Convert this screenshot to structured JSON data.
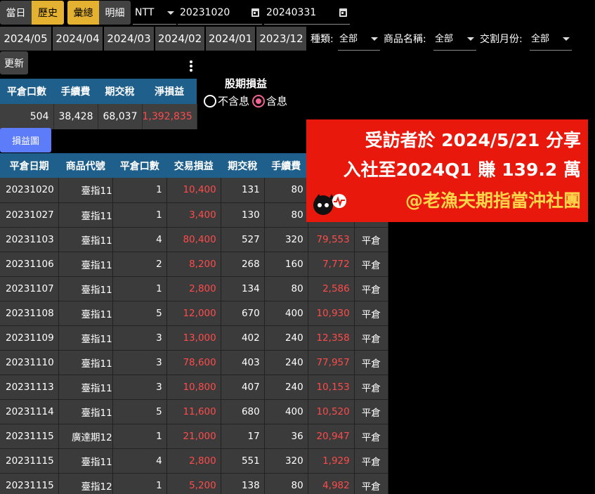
{
  "toolbar": {
    "range_tabs": [
      "當日",
      "歷史"
    ],
    "view_tabs": [
      "彙總",
      "明細"
    ],
    "currency": "NTT",
    "start_date": "20231020",
    "end_date": "20240331",
    "update_label": "更新",
    "chart_label": "損益圖"
  },
  "months": [
    "2024/05",
    "2024/04",
    "2024/03",
    "2024/02",
    "2024/01",
    "2023/12"
  ],
  "filters": {
    "type_label": "種類:",
    "type_value": "全部",
    "product_label": "商品名稱:",
    "product_value": "全部",
    "month_label": "交割月份:",
    "month_value": "全部"
  },
  "summary": {
    "headers": [
      "平倉口數",
      "手續費",
      "期交稅",
      "淨損益"
    ],
    "values": [
      "504",
      "38,428",
      "68,037",
      "1,392,835"
    ]
  },
  "interest": {
    "title": "股期損益",
    "options": [
      "不含息",
      "含息"
    ],
    "selected": "含息"
  },
  "detail": {
    "headers": [
      "平倉日期",
      "商品代號",
      "平倉口數",
      "交易損益",
      "期交稅",
      "手續費",
      "",
      ""
    ],
    "rows": [
      [
        "20231020",
        "臺指11",
        "1",
        "10,400",
        "131",
        "80",
        "",
        ""
      ],
      [
        "20231027",
        "臺指11",
        "1",
        "3,400",
        "130",
        "80",
        "",
        ""
      ],
      [
        "20231103",
        "臺指11",
        "4",
        "80,400",
        "527",
        "320",
        "79,553",
        "平倉"
      ],
      [
        "20231106",
        "臺指11",
        "2",
        "8,200",
        "268",
        "160",
        "7,772",
        "平倉"
      ],
      [
        "20231107",
        "臺指11",
        "1",
        "2,800",
        "134",
        "80",
        "2,586",
        "平倉"
      ],
      [
        "20231108",
        "臺指11",
        "5",
        "12,000",
        "670",
        "400",
        "10,930",
        "平倉"
      ],
      [
        "20231109",
        "臺指11",
        "3",
        "13,000",
        "402",
        "240",
        "12,358",
        "平倉"
      ],
      [
        "20231110",
        "臺指11",
        "3",
        "78,600",
        "403",
        "240",
        "77,957",
        "平倉"
      ],
      [
        "20231113",
        "臺指11",
        "3",
        "10,800",
        "407",
        "240",
        "10,153",
        "平倉"
      ],
      [
        "20231114",
        "臺指11",
        "5",
        "11,600",
        "680",
        "400",
        "10,520",
        "平倉"
      ],
      [
        "20231115",
        "廣達期12",
        "1",
        "21,000",
        "17",
        "36",
        "20,947",
        "平倉"
      ],
      [
        "20231115",
        "臺指11",
        "4",
        "2,800",
        "551",
        "320",
        "1,929",
        "平倉"
      ],
      [
        "20231115",
        "臺指12",
        "1",
        "5,200",
        "138",
        "80",
        "4,982",
        "平倉"
      ]
    ]
  },
  "banner": {
    "line1": "受訪者於 2024/5/21 分享",
    "line2": "入社至2024Q1 賺 139.2 萬",
    "line3": "@老漁夫期指當沖社團"
  },
  "colors": {
    "accent": "#e5b130",
    "header": "#1f5f8b",
    "profit": "#ff4b4b",
    "banner": "#e8190c"
  }
}
